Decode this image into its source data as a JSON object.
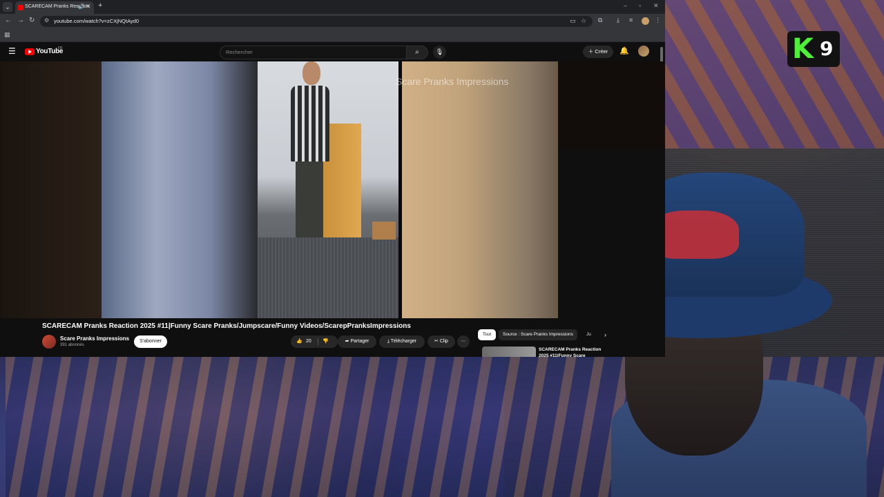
{
  "browser": {
    "tab": {
      "title": "SCARECAM Pranks Reaction",
      "favicon": "youtube-favicon-icon"
    },
    "address_bar": {
      "url": "youtube.com/watch?v=zCXjNQtAyd0"
    }
  },
  "youtube": {
    "logo_text": "YouTube",
    "region_code": "FR",
    "search": {
      "placeholder": "Rechercher"
    },
    "create_label": "Créer",
    "player": {
      "watermark": "Scare Pranks Impressions"
    },
    "video": {
      "title": "SCARECAM Pranks Reaction 2025 #11|Funny Scare Pranks/Jumpscare/Funny Videos/ScarepPranksImpressions",
      "channel_name": "Scare Pranks Impressions",
      "subscribers": "391 abonnés",
      "subscribe_label": "S'abonner",
      "likes": "20",
      "share_label": "Partager",
      "download_label": "Télécharger",
      "clip_label": "Clip"
    },
    "chips": {
      "all": "Tout",
      "source": "Source : Scare Pranks Impressions",
      "more": "Ju"
    },
    "recommendation": {
      "title": "SCARECAM Pranks Reaction 2025 #11|Funny Scare"
    }
  },
  "overlay": {
    "badge_letter": "K",
    "badge_number": "9",
    "badge_color": "#4ef03a"
  }
}
